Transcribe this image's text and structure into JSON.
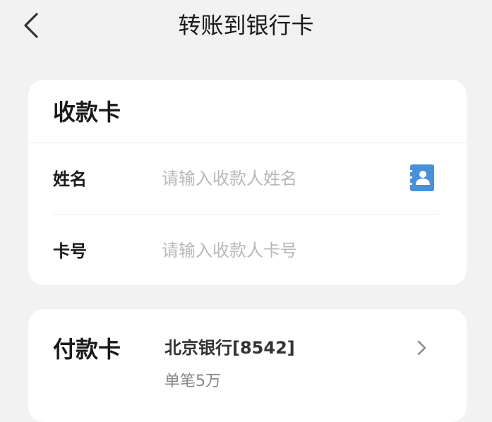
{
  "header": {
    "title": "转账到银行卡",
    "back_icon": "chevron-left-icon"
  },
  "payee_card": {
    "title": "收款卡",
    "name_label": "姓名",
    "name_placeholder": "请输入收款人姓名",
    "name_value": "",
    "contact_icon": "contact-book-icon",
    "card_label": "卡号",
    "card_placeholder": "请输入收款人卡号",
    "card_value": ""
  },
  "payer_card": {
    "title": "付款卡",
    "bank": "北京银行[8542]",
    "limit": "单笔5万",
    "arrow_icon": "chevron-right-icon"
  },
  "colors": {
    "background": "#f2f2f2",
    "card": "#ffffff",
    "contact_icon": "#4a90d9",
    "placeholder": "#b8b8b8"
  }
}
